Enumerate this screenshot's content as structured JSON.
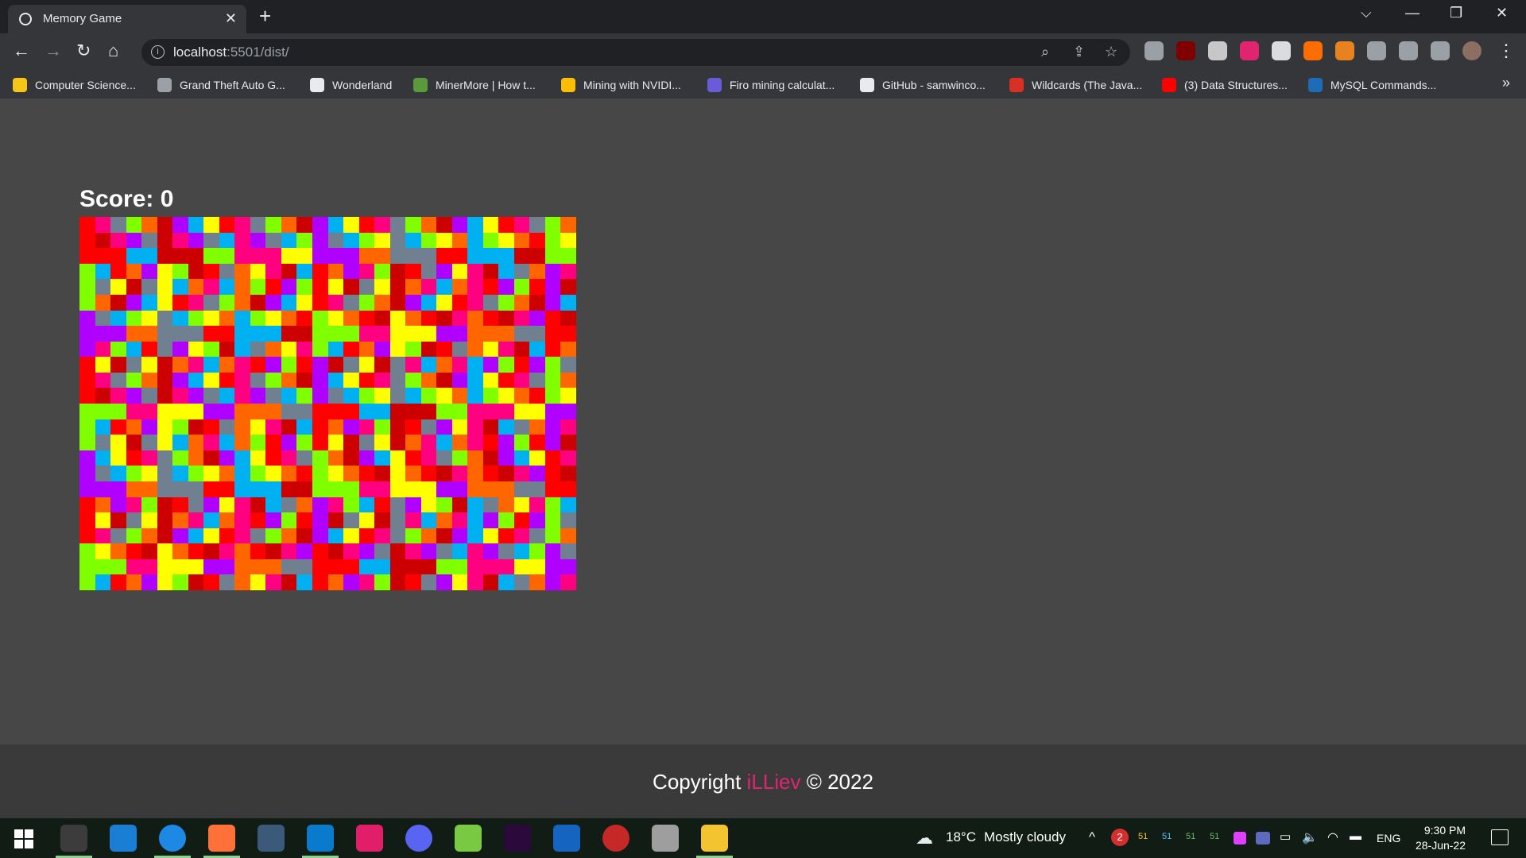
{
  "browser": {
    "tab_title": "Memory Game",
    "tab_close": "✕",
    "new_tab": "+",
    "url_host": "localhost",
    "url_rest": ":5501/dist/",
    "window_controls": {
      "dropdown": "⌵",
      "minimize": "—",
      "restore": "❐",
      "close": "✕"
    },
    "nav": {
      "back": "←",
      "forward": "→",
      "reload": "↻",
      "home": "⌂"
    },
    "omnibox_icons": {
      "zoom": "⌕",
      "share": "⇪",
      "bookmark": "☆"
    },
    "extension_colors": [
      "#9aa0a6",
      "#800000",
      "#c7c7c7",
      "#e0246f",
      "#dadce0",
      "#ff6d00",
      "#e8821e",
      "#9aa0a6",
      "#9aa0a6",
      "#9aa0a6"
    ],
    "bookmarks": [
      {
        "label": "Computer Science...",
        "color": "#f5c518"
      },
      {
        "label": "Grand Theft Auto G...",
        "color": "#9aa0a6"
      },
      {
        "label": "Wonderland",
        "color": "#e8eaed"
      },
      {
        "label": "MinerMore | How t...",
        "color": "#5a9a3a"
      },
      {
        "label": "Mining with NVIDI...",
        "color": "#fbbc04"
      },
      {
        "label": "Firo mining calculat...",
        "color": "#6b5bd6"
      },
      {
        "label": "GitHub - samwinco...",
        "color": "#e8eaed"
      },
      {
        "label": "Wildcards (The Java...",
        "color": "#d93025"
      },
      {
        "label": "(3) Data Structures...",
        "color": "#ff0000"
      },
      {
        "label": "MySQL Commands...",
        "color": "#1e6bb8"
      }
    ],
    "bookmarks_more": "»"
  },
  "game": {
    "score_label": "Score: 0",
    "palette": [
      "#ff0000",
      "#ff6600",
      "#ffff00",
      "#80ff00",
      "#00b0f0",
      "#708090",
      "#b000ff",
      "#ff0080",
      "#cc0000"
    ],
    "rows": 24,
    "cols": 32
  },
  "footer": {
    "prefix": "Copyright ",
    "brand": "iLLiev",
    "suffix": " © 2022"
  },
  "taskbar": {
    "apps": [
      {
        "name": "terminal",
        "color": "#3c3c3c"
      },
      {
        "name": "mail",
        "color": "#1a7fd4"
      },
      {
        "name": "chrome",
        "color": "#1e88e5"
      },
      {
        "name": "firefox",
        "color": "#ff7139"
      },
      {
        "name": "mysql-workbench",
        "color": "#3b5a7a"
      },
      {
        "name": "vscode",
        "color": "#0a7acc"
      },
      {
        "name": "intellij",
        "color": "#e01e6a"
      },
      {
        "name": "discord",
        "color": "#5865f2"
      },
      {
        "name": "bluestacks",
        "color": "#7ac943"
      },
      {
        "name": "premiere",
        "color": "#2a0a3a"
      },
      {
        "name": "app-blue",
        "color": "#1565c0"
      },
      {
        "name": "app-red",
        "color": "#c62828"
      },
      {
        "name": "printer",
        "color": "#9e9e9e"
      },
      {
        "name": "file-explorer",
        "color": "#f4c430"
      }
    ],
    "weather_temp": "18°C",
    "weather_desc": "Mostly cloudy",
    "tray_up": "^",
    "badge_count": "2",
    "tray_51": "51",
    "language": "ENG",
    "time": "9:30 PM",
    "date": "28-Jun-22"
  }
}
